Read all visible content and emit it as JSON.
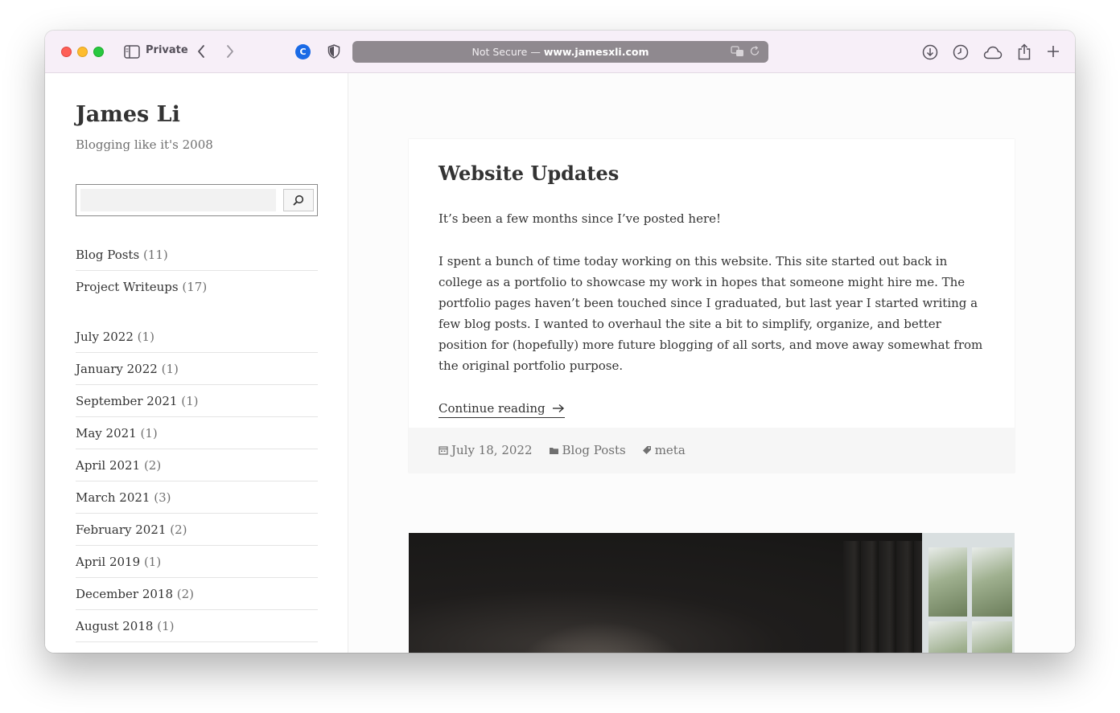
{
  "browser": {
    "private_label": "Private",
    "address_prefix": "Not Secure —",
    "address_domain": "www.jamesxli.com",
    "extension_letter": "C"
  },
  "sidebar": {
    "site_title": "James Li",
    "site_description": "Blogging like it's 2008",
    "search_placeholder": "",
    "categories": [
      {
        "label": "Blog Posts",
        "count": "(11)"
      },
      {
        "label": "Project Writeups",
        "count": "(17)"
      }
    ],
    "archives": [
      {
        "label": "July 2022",
        "count": "(1)"
      },
      {
        "label": "January 2022",
        "count": "(1)"
      },
      {
        "label": "September 2021",
        "count": "(1)"
      },
      {
        "label": "May 2021",
        "count": "(1)"
      },
      {
        "label": "April 2021",
        "count": "(2)"
      },
      {
        "label": "March 2021",
        "count": "(3)"
      },
      {
        "label": "February 2021",
        "count": "(2)"
      },
      {
        "label": "April 2019",
        "count": "(1)"
      },
      {
        "label": "December 2018",
        "count": "(2)"
      },
      {
        "label": "August 2018",
        "count": "(1)"
      }
    ]
  },
  "post": {
    "title": "Website Updates",
    "paragraph_1": "It’s been a few months since I’ve posted here!",
    "paragraph_2": "I spent a bunch of time today working on this website. This site started out back in college as a portfolio to showcase my work in hopes that someone might hire me. The portfolio pages haven’t been touched since I graduated, but last year I started writing a few blog posts. I wanted to overhaul the site a bit to simplify, organize, and better position for (hopefully) more future blogging of all sorts, and move away somewhat from the original portfolio purpose.",
    "continue_label": "Continue reading",
    "date": "July 18, 2022",
    "category": "Blog Posts",
    "tag": "meta"
  }
}
